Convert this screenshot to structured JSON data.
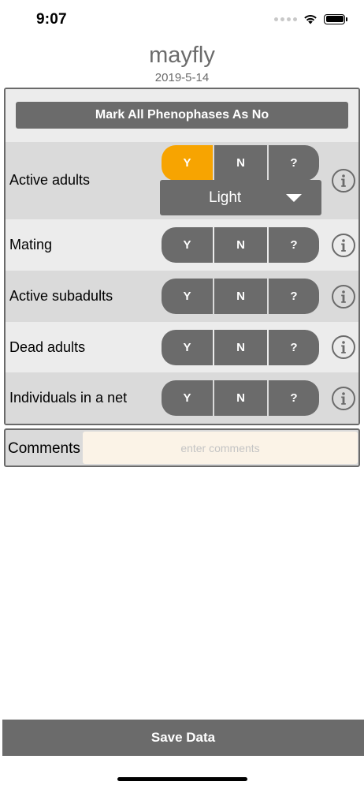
{
  "status_bar": {
    "time": "9:07",
    "icons": [
      "signal-dots-icon",
      "wifi-icon",
      "battery-icon"
    ]
  },
  "header": {
    "species": "mayfly",
    "date": "2019-5-14"
  },
  "panel": {
    "mark_all_label": "Mark All Phenophases As No",
    "phenophases": [
      {
        "label": "Active adults",
        "yes": "Y",
        "no": "N",
        "unknown": "?",
        "selected": "Y",
        "intensity": "Light"
      },
      {
        "label": "Mating",
        "yes": "Y",
        "no": "N",
        "unknown": "?",
        "selected": ""
      },
      {
        "label": "Active subadults",
        "yes": "Y",
        "no": "N",
        "unknown": "?",
        "selected": ""
      },
      {
        "label": "Dead adults",
        "yes": "Y",
        "no": "N",
        "unknown": "?",
        "selected": ""
      },
      {
        "label": "Individuals in a net",
        "yes": "Y",
        "no": "N",
        "unknown": "?",
        "selected": ""
      }
    ]
  },
  "comments": {
    "label": "Comments",
    "value": "",
    "placeholder": "enter comments"
  },
  "footer": {
    "save_label": "Save Data"
  },
  "colors": {
    "selected": "#f7a401",
    "control": "#6b6b6b",
    "row_dark": "#dadada",
    "row_light": "#ececec",
    "comments_bg": "#fbf3e7"
  }
}
